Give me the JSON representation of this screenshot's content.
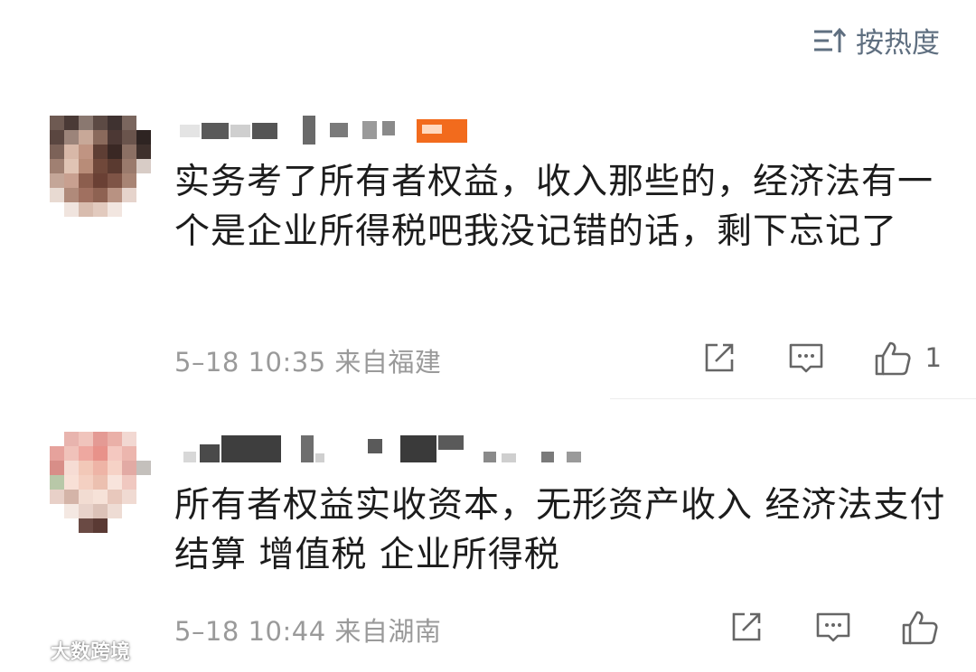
{
  "sort": {
    "label": "按热度",
    "icon": "sort-lines-icon"
  },
  "comments": [
    {
      "text": "实务考了所有者权益，收入那些的，经济法有一个是企业所得税吧我没记错的话，剩下忘记了",
      "meta": "5–18 10:35 来自福建",
      "like_count": "1"
    },
    {
      "text": "所有者权益实收资本，无形资产收入  经济法支付结算 增值税 企业所得税",
      "meta": "5–18 10:44 来自湖南",
      "like_count": ""
    }
  ],
  "watermark": {
    "text": "大数跨境"
  },
  "colors": {
    "meta_gray": "#9a9a9a",
    "icon_gray": "#666666",
    "sort_blue_gray": "#5f6f80",
    "badge_orange": "#f26b1d"
  }
}
